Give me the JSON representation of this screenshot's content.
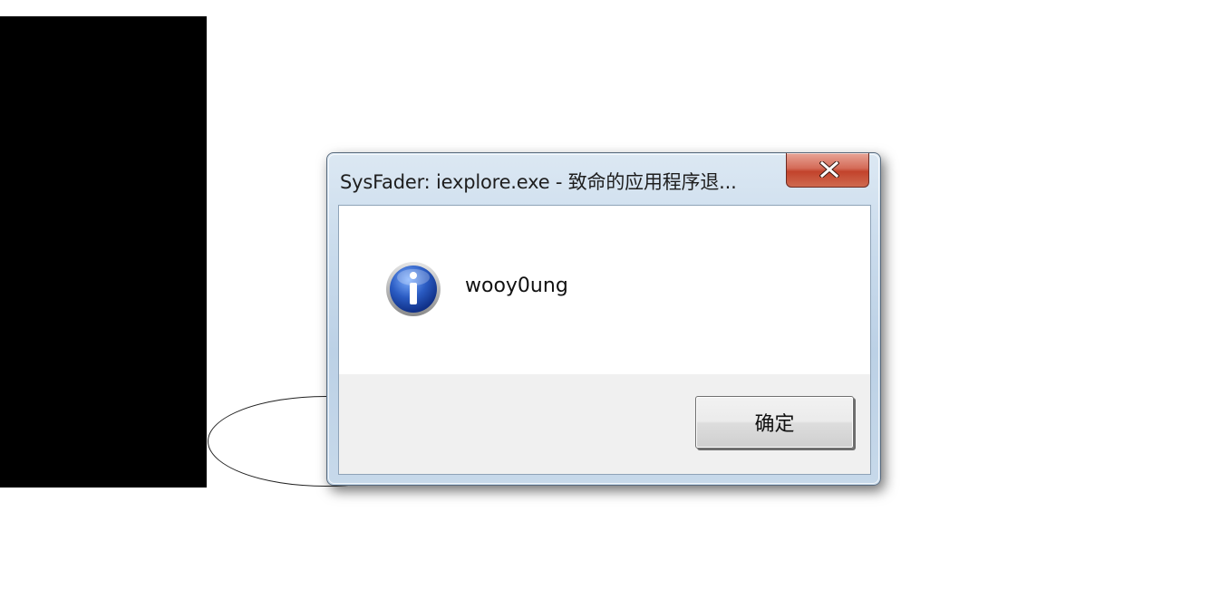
{
  "dialog": {
    "title": "SysFader: iexplore.exe - 致命的应用程序退...",
    "message": "wooy0ung",
    "ok_label": "确定",
    "icon": "info-icon",
    "close_icon": "close-icon"
  },
  "colors": {
    "close_button": "#c2432c",
    "info_icon_blue": "#2a5bc2",
    "button_bar": "#f0f0f0",
    "background_block": "#000000"
  }
}
